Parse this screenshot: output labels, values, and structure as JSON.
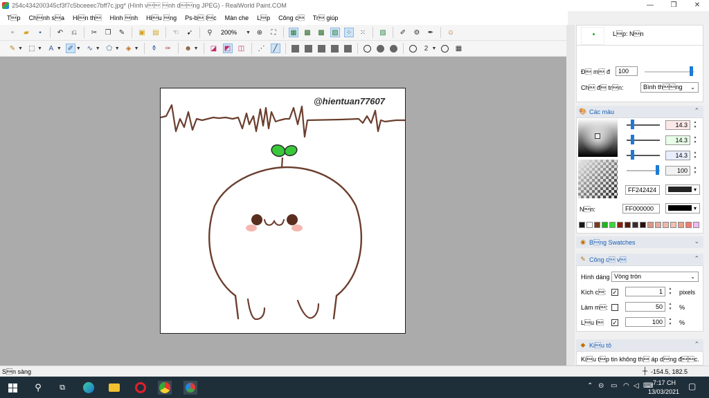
{
  "window": {
    "title": "254c434200345cf3f7c5bceeec7bff7c.jpg* (Hình v\u0010\u0010 \u0010nh d\u0010\u0010ng JPEG) - RealWorld Paint.COM",
    "minimize": "—",
    "maximize": "❒",
    "close": "✕"
  },
  "menu": [
    "T\u0010p",
    "Ch\u0010nh s\u0010a",
    "Hi\u0010n th\u0010",
    "Hình \u0010nh",
    "Hi\u0010u \u0010ng",
    "Ps-b\u0010 l\u0010c",
    "Màn che",
    "L\u0010p",
    "Công c\u0010",
    "Tr\u0010 giúp"
  ],
  "toolbar": {
    "zoom": "200%",
    "line_width": "2"
  },
  "canvas": {
    "watermark": "@hientuan77607"
  },
  "layers": {
    "label": "L\u0010p: N\u0010n",
    "opacity_label": "Đ\u0010 m\u0010 đ",
    "opacity_value": "100",
    "blend_label": "Ch\u0010 đ\u0010 tr\u0010n:",
    "blend_value": "Bình th\u0010\u0010ng"
  },
  "colors": {
    "title": "Các màu",
    "r": "14.3",
    "g": "14.3",
    "b": "14.3",
    "alpha": "100",
    "primary_hex": "FF242424",
    "primary_swatch": "#242424",
    "background_label": "N\u0010n:",
    "background_hex": "FF000000",
    "background_swatch": "#000000",
    "palette": [
      "#1a1a1a",
      "#ffffff",
      "#7a3b1a",
      "#1fb51f",
      "#3ad63a",
      "#8a1f10",
      "#5a1a0a",
      "#3a2a2a",
      "#2a0e0e",
      "#d89a8a",
      "#e2aaa0",
      "#f0b8a8",
      "#f2c0b0",
      "#e8a088",
      "#f07a70",
      "#f2b8f2"
    ]
  },
  "swatches": {
    "title": "B\u0010ng Swatches"
  },
  "tool": {
    "title": "Công c\u0010 v\u0010",
    "shape_label": "Hình dáng",
    "shape_value": "Vòng tròn",
    "size_label": "Kích c\u0010:",
    "size_value": "1",
    "size_unit": "pixels",
    "smooth_label": "Làm m\u0010:",
    "smooth_value": "50",
    "smooth_unit": "%",
    "flow_label": "L\u0010u l\u0010",
    "flow_value": "100",
    "flow_unit": "%",
    "check_mark": "✓"
  },
  "fill": {
    "title": "Ki\u0010u tô",
    "desc": "Ki\u0010u t\u0010p tin không th\u0010 áp d\u0010ng đ\u0010\u0010c."
  },
  "status": {
    "left": "S\u0010n sàng",
    "coords": "-154.5, 182.5"
  },
  "taskbar": {
    "time": "7:17 CH",
    "date": "13/03/2021"
  }
}
